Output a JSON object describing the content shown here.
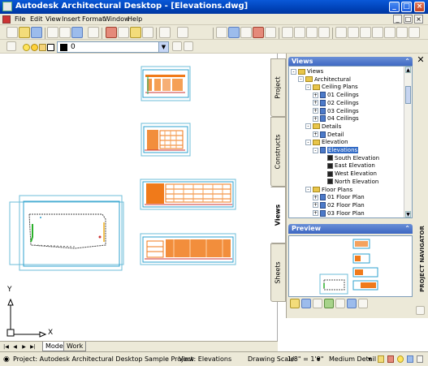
{
  "window": {
    "title": "Autodesk Architectural Desktop  - [Elevations.dwg]"
  },
  "menu": [
    "File",
    "Edit",
    "View",
    "Insert",
    "Format",
    "Window",
    "Help"
  ],
  "layer": {
    "current": "0"
  },
  "icons": {
    "minimize": "minimize-icon",
    "maximize": "maximize-icon",
    "close": "close-icon",
    "palette_close": "close-icon"
  },
  "ucs": {
    "y_label": "Y",
    "x_label": "X"
  },
  "tabs": {
    "project": "Project",
    "constructs": "Constructs",
    "views": "Views",
    "sheets": "Sheets"
  },
  "views_panel": {
    "header": "Views",
    "tree": [
      {
        "label": "Views",
        "depth": 0,
        "kind": "folder",
        "exp": "-"
      },
      {
        "label": "Architectural",
        "depth": 1,
        "kind": "folder",
        "exp": "-"
      },
      {
        "label": "Ceiling Plans",
        "depth": 2,
        "kind": "folder",
        "exp": "-"
      },
      {
        "label": "01 Ceilings",
        "depth": 3,
        "kind": "dwg",
        "exp": "+"
      },
      {
        "label": "02 Ceilings",
        "depth": 3,
        "kind": "dwg",
        "exp": "+"
      },
      {
        "label": "03 Ceilings",
        "depth": 3,
        "kind": "dwg",
        "exp": "+"
      },
      {
        "label": "04 Ceilings",
        "depth": 3,
        "kind": "dwg",
        "exp": "+"
      },
      {
        "label": "Details",
        "depth": 2,
        "kind": "folder",
        "exp": "-"
      },
      {
        "label": "Detail",
        "depth": 3,
        "kind": "dwg",
        "exp": "+"
      },
      {
        "label": "Elevation",
        "depth": 2,
        "kind": "folder",
        "exp": "-"
      },
      {
        "label": "Elevations",
        "depth": 3,
        "kind": "dwg",
        "exp": "-",
        "selected": true
      },
      {
        "label": "South Elevation",
        "depth": 4,
        "kind": "view",
        "exp": ""
      },
      {
        "label": "East Elevation",
        "depth": 4,
        "kind": "view",
        "exp": ""
      },
      {
        "label": "West Elevation",
        "depth": 4,
        "kind": "view",
        "exp": ""
      },
      {
        "label": "North Elevation",
        "depth": 4,
        "kind": "view",
        "exp": ""
      },
      {
        "label": "Floor Plans",
        "depth": 2,
        "kind": "folder",
        "exp": "-"
      },
      {
        "label": "01 Floor Plan",
        "depth": 3,
        "kind": "dwg",
        "exp": "+"
      },
      {
        "label": "02 Floor Plan",
        "depth": 3,
        "kind": "dwg",
        "exp": "+"
      },
      {
        "label": "03 Floor Plan",
        "depth": 3,
        "kind": "dwg",
        "exp": "+"
      }
    ]
  },
  "preview_panel": {
    "header": "Preview"
  },
  "navigator_label": "PROJECT NAVIGATOR",
  "layout_tabs": [
    "Model",
    "Work"
  ],
  "status": {
    "project": "Project: Autodesk Architectural Desktop Sample Project",
    "view": "View: Elevations",
    "scale_label": "Drawing Scale:",
    "scale_value": "1/8\" = 1'0\"",
    "detail": "Medium Detail"
  },
  "colors": {
    "accent": "#0a58d8",
    "drawing_orange": "#f07a1a",
    "view_cyan": "#2da2cf"
  }
}
